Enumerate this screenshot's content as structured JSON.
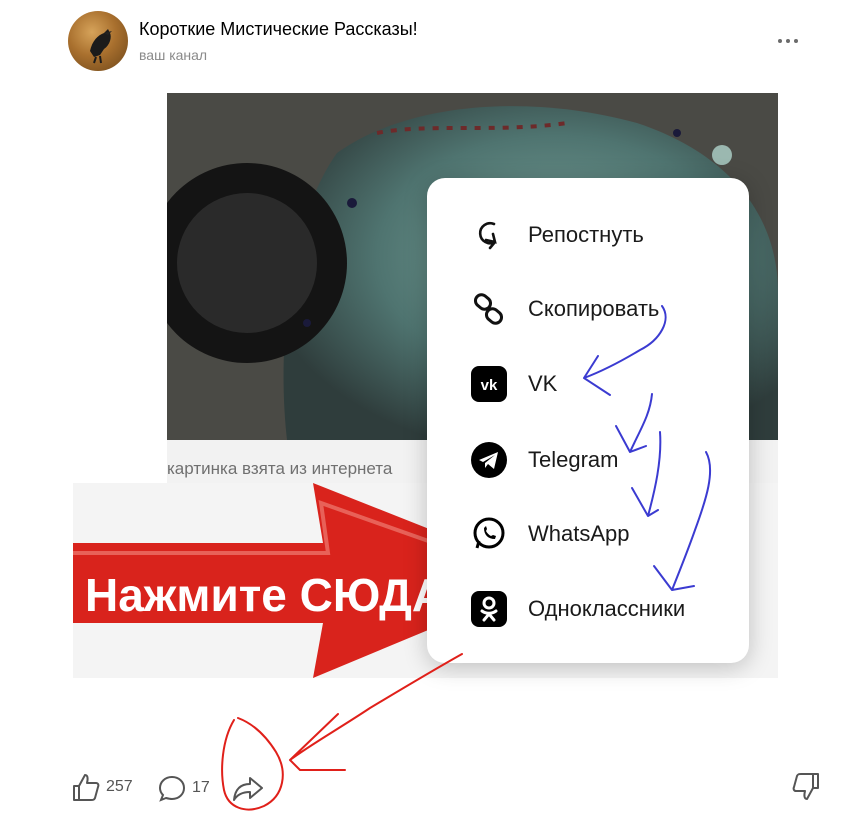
{
  "header": {
    "channel_title": "Короткие Мистические Рассказы!",
    "channel_subtitle": "ваш канал"
  },
  "post": {
    "caption": "картинка взята из интернета",
    "banner_text": "Нажмите СЮДА"
  },
  "share_menu": {
    "items": [
      {
        "label": "Репостнуть",
        "icon": "repost-icon"
      },
      {
        "label": "Скопировать",
        "icon": "link-icon"
      },
      {
        "label": "VK",
        "icon": "vk-icon"
      },
      {
        "label": "Telegram",
        "icon": "telegram-icon"
      },
      {
        "label": "WhatsApp",
        "icon": "whatsapp-icon"
      },
      {
        "label": "Одноклассники",
        "icon": "odnoklassniki-icon"
      }
    ]
  },
  "footer": {
    "likes": "257",
    "comments": "17"
  },
  "colors": {
    "banner_red": "#d9231c",
    "annotation_blue": "#3b3bd1",
    "annotation_red": "#e0201a"
  }
}
